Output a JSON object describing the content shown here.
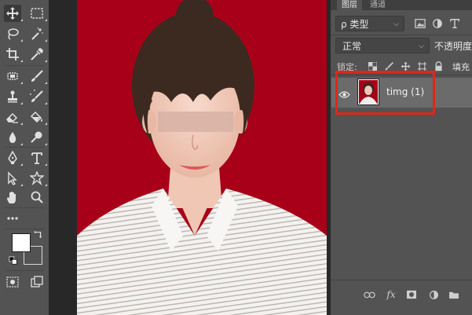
{
  "panel": {
    "tabs": [
      {
        "label": "图层"
      },
      {
        "label": "通道"
      }
    ],
    "filter": {
      "label": "ρ 类型"
    },
    "blend_mode": {
      "label": "正常"
    },
    "opacity_label": "不透明度",
    "lock_label": "锁定:",
    "fill_label": "填充",
    "layer": {
      "name": "timg (1)"
    }
  },
  "colors": {
    "background_red": "#a80018",
    "highlight_red": "#e02717"
  },
  "icons": {
    "tools": [
      "move-icon",
      "marquee-icon",
      "lasso-icon",
      "magic-wand-icon",
      "crop-icon",
      "eyedropper-icon",
      "healing-brush-icon",
      "brush-icon",
      "clone-stamp-icon",
      "history-brush-icon",
      "eraser-icon",
      "paint-bucket-icon",
      "blur-icon",
      "dodge-icon",
      "pen-icon",
      "type-icon",
      "path-selection-icon",
      "shape-icon",
      "hand-icon",
      "zoom-icon",
      "more-tools-icon",
      "quick-mask-icon",
      "screen-mode-icon"
    ]
  }
}
